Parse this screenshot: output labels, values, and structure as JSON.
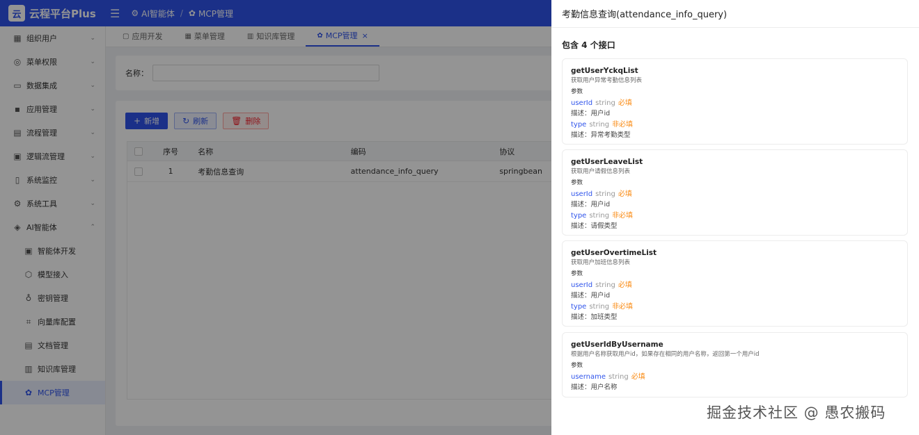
{
  "app": {
    "logo_char": "云",
    "name": "云程平台Plus"
  },
  "breadcrumb": [
    {
      "icon": "robot-icon",
      "glyph": "⚙",
      "label": "AI智能体"
    },
    {
      "icon": "gear-icon",
      "glyph": "✿",
      "label": "MCP管理"
    }
  ],
  "sidebar": {
    "items": [
      {
        "label": "组织用户",
        "glyph": "▦",
        "icon": "org-icon"
      },
      {
        "label": "菜单权限",
        "glyph": "◎",
        "icon": "menu-permission-icon"
      },
      {
        "label": "数据集成",
        "glyph": "▭",
        "icon": "data-icon"
      },
      {
        "label": "应用管理",
        "glyph": "▪",
        "icon": "app-icon"
      },
      {
        "label": "流程管理",
        "glyph": "▤",
        "icon": "flow-icon"
      },
      {
        "label": "逻辑流管理",
        "glyph": "▣",
        "icon": "logic-flow-icon"
      },
      {
        "label": "系统监控",
        "glyph": "▯",
        "icon": "monitor-icon"
      },
      {
        "label": "系统工具",
        "glyph": "⚙",
        "icon": "tools-icon"
      },
      {
        "label": "AI智能体",
        "glyph": "◈",
        "icon": "ai-agent-icon"
      }
    ],
    "sub_items": [
      {
        "label": "智能体开发",
        "glyph": "▣",
        "icon": "agent-dev-icon"
      },
      {
        "label": "模型接入",
        "glyph": "⬡",
        "icon": "model-icon"
      },
      {
        "label": "密钥管理",
        "glyph": "♁",
        "icon": "key-icon"
      },
      {
        "label": "向量库配置",
        "glyph": "⌗",
        "icon": "vector-icon"
      },
      {
        "label": "文档管理",
        "glyph": "▤",
        "icon": "document-icon"
      },
      {
        "label": "知识库管理",
        "glyph": "▥",
        "icon": "knowledge-icon"
      },
      {
        "label": "MCP管理",
        "glyph": "✿",
        "icon": "mcp-icon"
      }
    ]
  },
  "tabs": [
    {
      "label": "应用开发",
      "glyph": "▢"
    },
    {
      "label": "菜单管理",
      "glyph": "▦"
    },
    {
      "label": "知识库管理",
      "glyph": "▥"
    },
    {
      "label": "MCP管理",
      "glyph": "✿",
      "close": "×"
    }
  ],
  "search": {
    "label": "名称：",
    "value": ""
  },
  "toolbar": {
    "add": "新增",
    "refresh": "刷新",
    "delete": "删除"
  },
  "table": {
    "headers": {
      "index": "序号",
      "name": "名称",
      "code": "编码",
      "protocol": "协议"
    },
    "rows": [
      {
        "index": "1",
        "name": "考勤信息查询",
        "code": "attendance_info_query",
        "protocol": "springbean"
      }
    ]
  },
  "drawer": {
    "title": "考勤信息查询(attendance_info_query)",
    "count_text": "包含 4 个接口",
    "params_label": "参数",
    "apis": [
      {
        "name": "getUserYckqList",
        "desc": "获取用户异常考勤信息列表",
        "params": [
          {
            "name": "userId",
            "type": "string",
            "flag": "必填",
            "desc": "描述：用户id"
          },
          {
            "name": "type",
            "type": "string",
            "flag": "非必填",
            "desc": "描述：异常考勤类型"
          }
        ]
      },
      {
        "name": "getUserLeaveList",
        "desc": "获取用户请假信息列表",
        "params": [
          {
            "name": "userId",
            "type": "string",
            "flag": "必填",
            "desc": "描述：用户id"
          },
          {
            "name": "type",
            "type": "string",
            "flag": "非必填",
            "desc": "描述：请假类型"
          }
        ]
      },
      {
        "name": "getUserOvertimeList",
        "desc": "获取用户加班信息列表",
        "params": [
          {
            "name": "userId",
            "type": "string",
            "flag": "必填",
            "desc": "描述：用户id"
          },
          {
            "name": "type",
            "type": "string",
            "flag": "非必填",
            "desc": "描述：加班类型"
          }
        ]
      },
      {
        "name": "getUserIdByUsername",
        "desc": "根据用户名称获取用户id，如果存在相同的用户名称，返回第一个用户id",
        "params": [
          {
            "name": "username",
            "type": "string",
            "flag": "必填",
            "desc": "描述：用户名称"
          }
        ]
      }
    ]
  },
  "watermark": "掘金技术社区 @ 愚农搬码",
  "colors": {
    "primary": "#2f54eb",
    "required": "#fa8c16",
    "danger": "#f5222d"
  }
}
